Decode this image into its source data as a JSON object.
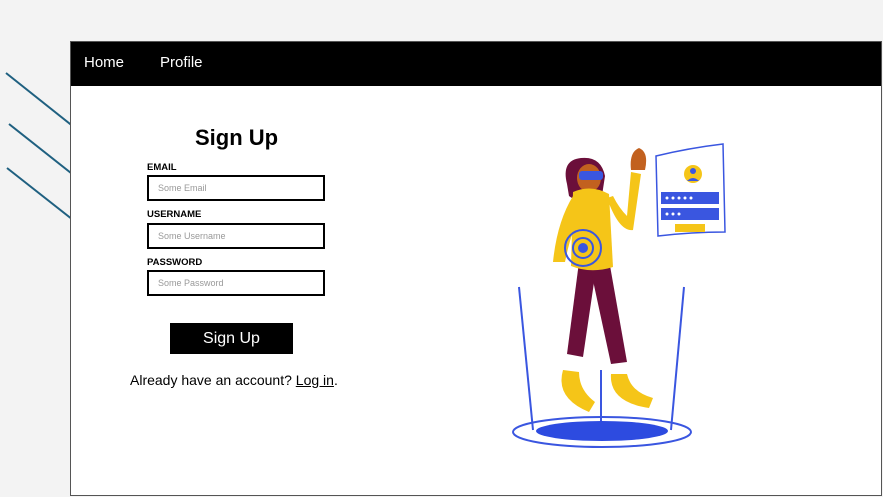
{
  "nav": {
    "home": "Home",
    "profile": "Profile"
  },
  "form": {
    "title": "Sign Up",
    "email_label": "EMAIL",
    "email_placeholder": "Some Email",
    "username_label": "USERNAME",
    "username_placeholder": "Some Username",
    "password_label": "PASSWORD",
    "password_placeholder": "Some Password",
    "submit_label": "Sign Up"
  },
  "footer": {
    "prompt": "Already have an account?",
    "link": "Log in",
    "suffix": "."
  },
  "colors": {
    "navbar": "#000000",
    "annotation_arrow": "#1f6080",
    "illustration_blue": "#3a56e0",
    "illustration_yellow": "#f5c518",
    "illustration_maroon": "#6b0f3a"
  }
}
